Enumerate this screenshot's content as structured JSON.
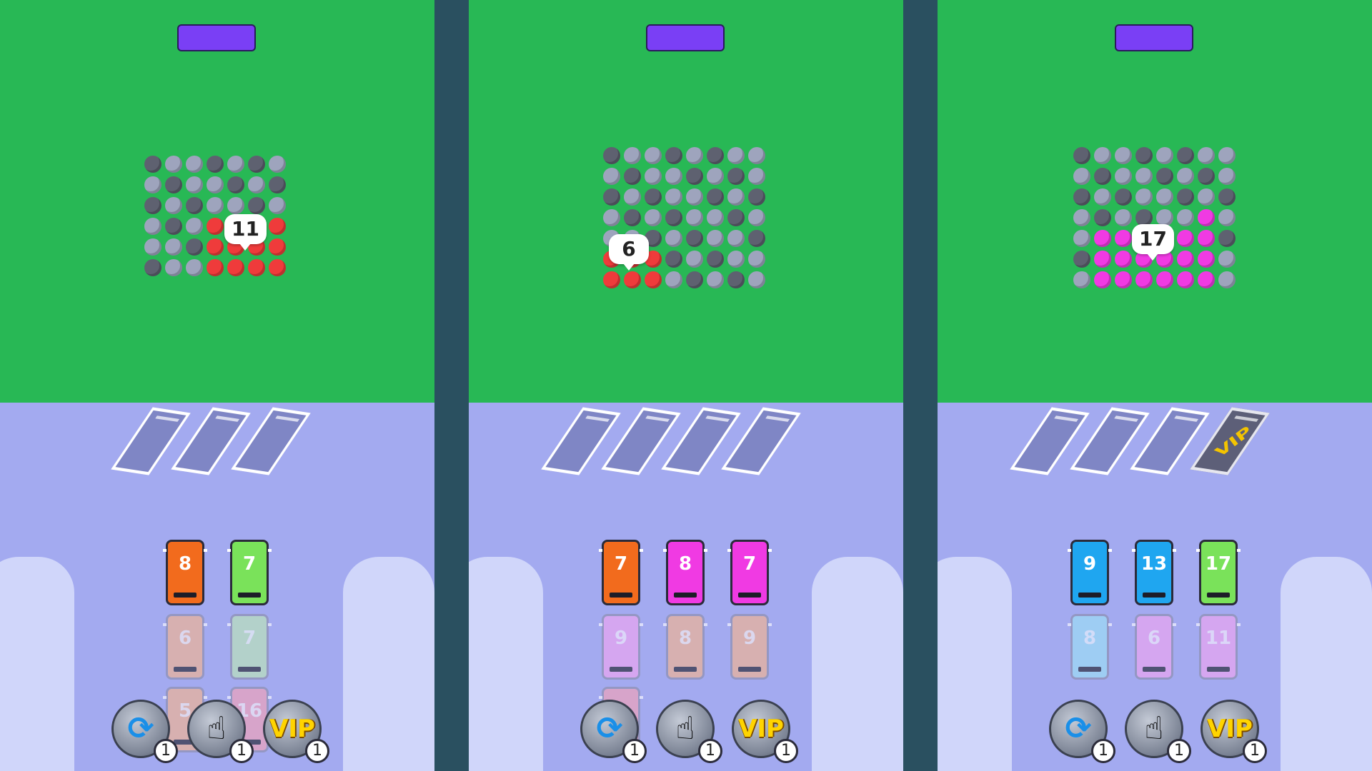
{
  "panels": [
    {
      "crowd_count": "11",
      "parking_slots": [
        "",
        "",
        ""
      ],
      "buses_top": [
        {
          "number": "8",
          "color": "#f26b1d"
        },
        {
          "number": "7",
          "color": "#7ae25a"
        }
      ],
      "buses_second": [
        {
          "number": "6",
          "color": "#f7b58a"
        },
        {
          "number": "7",
          "color": "#bdeab3"
        }
      ],
      "buses_third": [
        {
          "number": "5",
          "color": "#f7b58a"
        },
        {
          "number": "16",
          "color": "#f7a1b3"
        }
      ],
      "crowd_highlight": "#ef3b3b",
      "buttons": [
        {
          "icon": "refresh-icon",
          "count": "1"
        },
        {
          "icon": "hand-icon",
          "count": "1"
        },
        {
          "icon": "vip-icon",
          "label": "VIP",
          "count": "1"
        }
      ]
    },
    {
      "crowd_count": "6",
      "parking_slots": [
        "",
        "",
        "",
        ""
      ],
      "buses_top": [
        {
          "number": "7",
          "color": "#f26b1d"
        },
        {
          "number": "8",
          "color": "#f03ae3"
        },
        {
          "number": "7",
          "color": "#f03ae3"
        }
      ],
      "buses_second": [
        {
          "number": "9",
          "color": "#f5a4f0"
        },
        {
          "number": "8",
          "color": "#f7b58a"
        },
        {
          "number": "9",
          "color": "#f7b58a"
        }
      ],
      "crowd_highlight": "#ef3b3b",
      "buttons": [
        {
          "icon": "refresh-icon",
          "count": "1"
        },
        {
          "icon": "hand-icon",
          "count": "1"
        },
        {
          "icon": "vip-icon",
          "label": "VIP",
          "count": "1"
        }
      ]
    },
    {
      "crowd_count": "17",
      "parking_slots": [
        "",
        "",
        "",
        "VIP"
      ],
      "buses_top": [
        {
          "number": "9",
          "color": "#1fa6f0"
        },
        {
          "number": "13",
          "color": "#1fa6f0"
        },
        {
          "number": "17",
          "color": "#7ae25a"
        }
      ],
      "buses_second": [
        {
          "number": "8",
          "color": "#9be3f6"
        },
        {
          "number": "6",
          "color": "#f5a4f0"
        },
        {
          "number": "11",
          "color": "#f5a4f0"
        }
      ],
      "crowd_highlight": "#f03ae3",
      "buttons": [
        {
          "icon": "refresh-icon",
          "count": "1"
        },
        {
          "icon": "hand-icon",
          "count": "1"
        },
        {
          "icon": "vip-icon",
          "label": "VIP",
          "count": "1"
        }
      ]
    }
  ]
}
